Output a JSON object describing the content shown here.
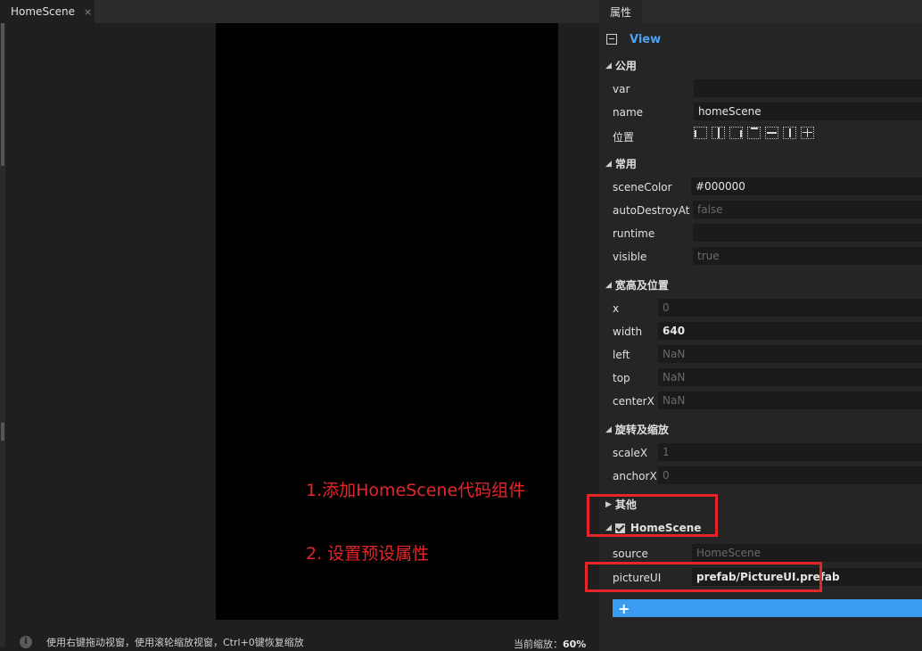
{
  "editor": {
    "tab_title": "HomeScene",
    "tab_close": "×",
    "annotation_1": "1.添加HomeScene代码组件",
    "annotation_2": "2. 设置预设属性",
    "status_text": "使用右键拖动视窗，使用滚轮缩放视窗，Ctrl+0键恢复缩放",
    "zoom_label": "当前缩放：",
    "zoom_value": "60%"
  },
  "panel": {
    "tab_title": "属性",
    "view_title": "View",
    "sections": {
      "common": "公用",
      "usual": "常用",
      "size_pos": "宽高及位置",
      "rotate_scale": "旋转及缩放",
      "other": "其他",
      "component": "HomeScene"
    },
    "props": {
      "var_label": "var",
      "var_value": "",
      "name_label": "name",
      "name_value": "homeScene",
      "pos_label": "位置",
      "sceneColor_label": "sceneColor",
      "sceneColor_value": "#000000",
      "autoDestroyAt_label": "autoDestroyAt",
      "autoDestroyAt_value": "false",
      "runtime_label": "runtime",
      "runtime_value": "",
      "visible_label": "visible",
      "visible_value": "true",
      "x_label": "x",
      "x_value": "0",
      "width_label": "width",
      "width_value": "640",
      "left_label": "left",
      "left_value": "NaN",
      "top_label": "top",
      "top_value": "NaN",
      "centerX_label": "centerX",
      "centerX_value": "NaN",
      "scaleX_label": "scaleX",
      "scaleX_value": "1",
      "anchorX_label": "anchorX",
      "anchorX_value": "0",
      "source_label": "source",
      "source_value": "HomeScene",
      "pictureUI_label": "pictureUI",
      "pictureUI_value": "prefab/PictureUI.prefab"
    },
    "add_button": "+"
  },
  "colors": {
    "accent": "#4ea3f0",
    "annotation": "#e4262b",
    "add_bar": "#3a9cf0"
  }
}
